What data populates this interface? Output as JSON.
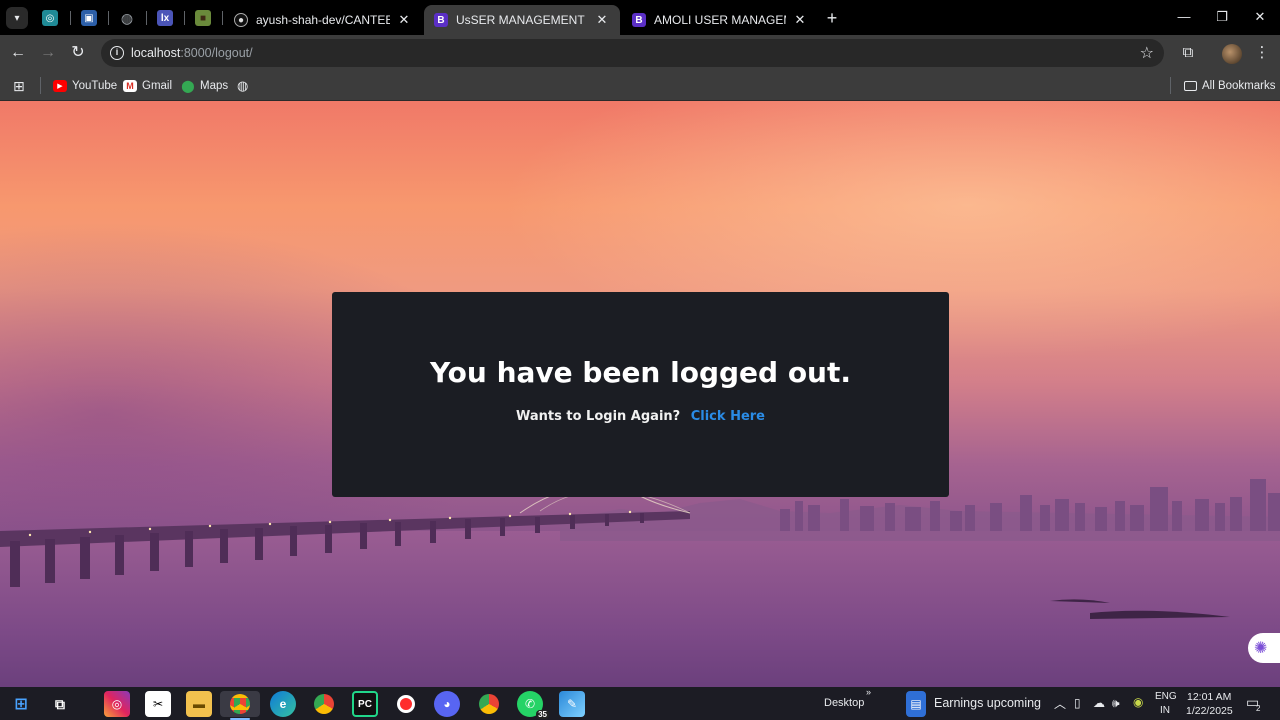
{
  "browser": {
    "pinned_tabs": [
      {
        "icon": "cloud-app-icon",
        "color": "#27b6c8",
        "glyph": "◎"
      },
      {
        "icon": "box-app-icon",
        "color": "#3a7bd5",
        "glyph": "▣"
      },
      {
        "icon": "globe-icon",
        "color": "#9aa0a6",
        "glyph": "◍"
      },
      {
        "icon": "lx-app-icon",
        "color": "#5b66c9",
        "glyph": "lx"
      },
      {
        "icon": "minecraft-icon",
        "color": "#6a8a3b",
        "glyph": "■"
      }
    ],
    "tabs": [
      {
        "title": "ayush-shah-dev/CANTEEN_MA",
        "icon": "github-icon",
        "active": false
      },
      {
        "title": "UsSER MANAGEMENT",
        "icon": "bootstrap-icon",
        "active": true
      },
      {
        "title": "AMOLI USER MANAGEMENT S\\",
        "icon": "bootstrap-icon",
        "active": false
      }
    ],
    "url_host": "localhost",
    "url_rest": ":8000/logout/",
    "bookmarks": [
      {
        "label": "YouTube",
        "icon": "youtube-icon"
      },
      {
        "label": "Gmail",
        "icon": "gmail-icon"
      },
      {
        "label": "Maps",
        "icon": "maps-icon"
      }
    ],
    "all_bookmarks_label": "All Bookmarks"
  },
  "page": {
    "heading": "You have been logged out.",
    "prompt": "Wants to Login Again?",
    "link_label": "Click Here"
  },
  "taskbar": {
    "apps": [
      "instagram-icon",
      "capcut-icon",
      "file-explorer-icon",
      "chrome-icon",
      "edge-icon",
      "chrome-alt-icon",
      "pycharm-icon",
      "recorder-icon",
      "discord-icon",
      "chrome-profile-icon",
      "whatsapp-icon",
      "paint-icon"
    ],
    "whatsapp_badge": "35",
    "desktop_label": "Desktop",
    "news_label": "Earnings upcoming",
    "lang_top": "ENG",
    "lang_bottom": "IN",
    "time": "12:01 AM",
    "date": "1/22/2025",
    "notification_count": "2"
  }
}
